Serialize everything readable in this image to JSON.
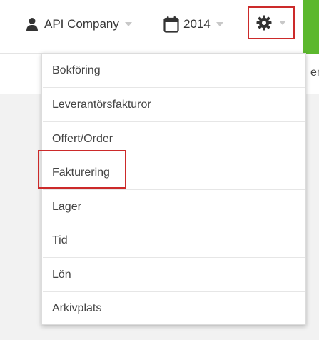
{
  "topbar": {
    "company": {
      "icon": "user-icon",
      "label": "API Company"
    },
    "year": {
      "icon": "calendar-icon",
      "label": "2014"
    },
    "settings": {
      "icon": "gear-icon"
    }
  },
  "subbar": {
    "partial_text": "er"
  },
  "menu": {
    "items": [
      {
        "label": "Bokföring"
      },
      {
        "label": "Leverantörsfakturor"
      },
      {
        "label": "Offert/Order"
      },
      {
        "label": "Fakturering"
      },
      {
        "label": "Lager"
      },
      {
        "label": "Tid"
      },
      {
        "label": "Lön"
      },
      {
        "label": "Arkivplats"
      }
    ]
  },
  "colors": {
    "accent_green": "#5cb82e",
    "highlight_red": "#cc2a2a"
  }
}
